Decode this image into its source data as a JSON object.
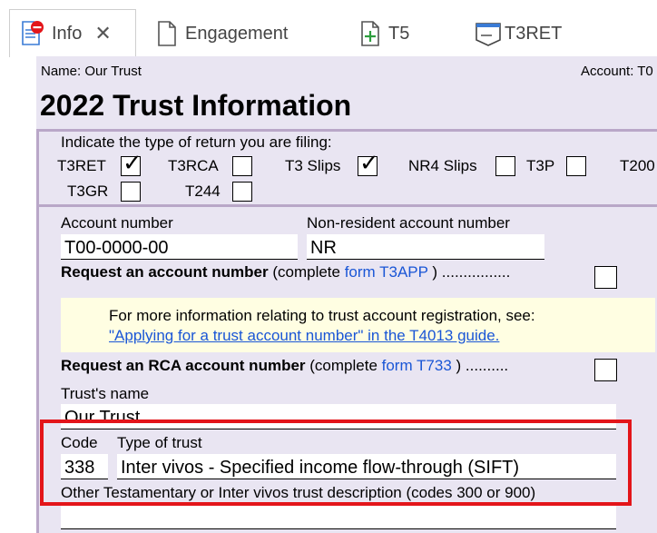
{
  "tabs": [
    {
      "label": "Info",
      "icon": "document-info-icon",
      "active": true
    },
    {
      "label": "Engagement",
      "icon": "document-icon"
    },
    {
      "label": "T5",
      "icon": "document-plus-icon"
    },
    {
      "label": "T3RET",
      "icon": "form-tray-icon"
    }
  ],
  "header": {
    "name": "Name: Our Trust",
    "account": "Account: T0",
    "title": "2022 Trust Information"
  },
  "returns": {
    "prompt": "Indicate the type of return you are filing:",
    "items": [
      {
        "label": "T3RET",
        "checked": true
      },
      {
        "label": "T3RCA",
        "checked": false
      },
      {
        "label": "T3 Slips",
        "checked": true
      },
      {
        "label": "NR4 Slips",
        "checked": false
      },
      {
        "label": "T3P",
        "checked": false
      },
      {
        "label": "T200",
        "checked": false
      },
      {
        "label": "T3GR",
        "checked": false
      },
      {
        "label": "T244",
        "checked": false
      }
    ],
    "check_mark": "✓"
  },
  "account": {
    "account_label": "Account number",
    "account_value": "T00-0000-00",
    "nonres_label": "Non-resident account number",
    "nonres_value": "NR",
    "request_bold": "Request an account number",
    "request_pre": " (complete ",
    "request_link": "form T3APP",
    "request_post": " )  ................",
    "info_line": "For more information relating to trust account registration, see:",
    "info_link": "\"Applying for a trust account number\" in the T4013 guide.",
    "rca_bold": "Request an RCA account number",
    "rca_pre": " (complete ",
    "rca_link": "form T733",
    "rca_post": " )  .........."
  },
  "trust": {
    "name_label": "Trust's name",
    "name_value": "Our Trust",
    "code_label": "Code",
    "code_value": "338",
    "type_label": "Type of trust",
    "type_value": "Inter vivos - Specified income flow-through (SIFT)",
    "other_label": "Other Testamentary or Inter vivos trust description (codes 300 or 900)"
  },
  "colors": {
    "accent_link": "#1a56d6",
    "highlight_box": "#e3151a",
    "form_bg": "#e9e5f2",
    "divider": "#b9a7c8",
    "info_bg": "#fffee2"
  }
}
